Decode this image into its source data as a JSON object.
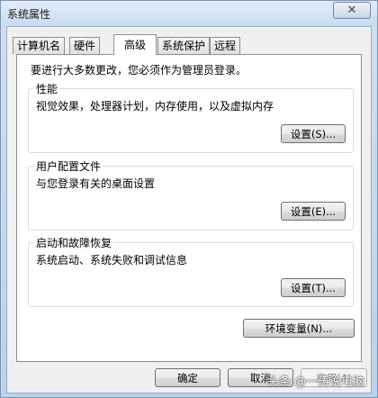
{
  "window": {
    "title": "系统属性",
    "close_glyph": "✕"
  },
  "tabs": [
    {
      "label": "计算机名"
    },
    {
      "label": "硬件"
    },
    {
      "label": "高级",
      "active": true
    },
    {
      "label": "系统保护"
    },
    {
      "label": "远程"
    }
  ],
  "admin_note": "要进行大多数更改，您必须作为管理员登录。",
  "performance": {
    "title": "性能",
    "description": "视觉效果，处理器计划，内存使用，以及虚拟内存",
    "button": "设置(S)..."
  },
  "user_profiles": {
    "title": "用户配置文件",
    "description": "与您登录有关的桌面设置",
    "button": "设置(E)..."
  },
  "startup_recovery": {
    "title": "启动和故障恢复",
    "description": "系统启动、系统失败和调试信息",
    "button": "设置(T)..."
  },
  "env_button": "环境变量(N)...",
  "footer": {
    "ok": "确定",
    "cancel": "取消",
    "apply": "应用(A)"
  },
  "watermark": "头条 @一涛说电脑",
  "icons": {
    "close": "close-icon"
  }
}
